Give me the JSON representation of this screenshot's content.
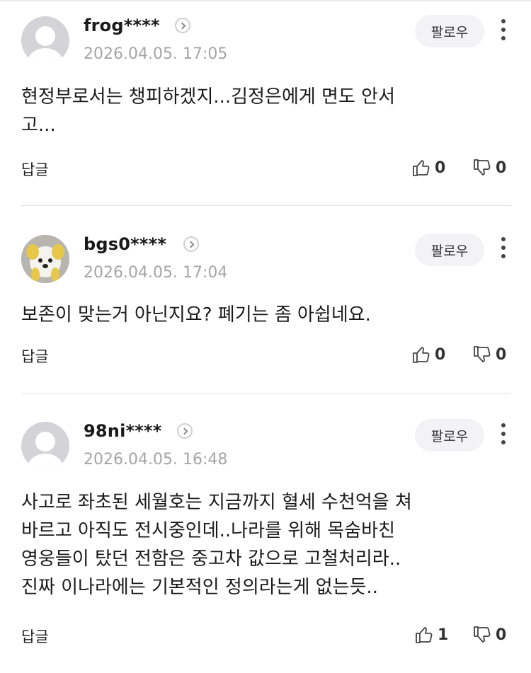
{
  "comments": [
    {
      "nickname": "frog****",
      "avatar": "default-avatar",
      "date": "2026.04.05. 17:05",
      "follow_label": "팔로우",
      "text": "현정부로서는 챙피하겠지...김정은에게 면도 안서\n고...",
      "reply_label": "답글",
      "likes": "0",
      "dislikes": "0"
    },
    {
      "nickname": "bgs0****",
      "avatar": "dog-photo-avatar",
      "date": "2026.04.05. 17:04",
      "follow_label": "팔로우",
      "text": "보존이 맞는거 아닌지요? 폐기는 좀 아쉽네요.",
      "reply_label": "답글",
      "likes": "0",
      "dislikes": "0"
    },
    {
      "nickname": "98ni****",
      "avatar": "default-avatar",
      "date": "2026.04.05. 16:48",
      "follow_label": "팔로우",
      "text": "사고로 좌초된 세월호는 지금까지 혈세 수천억을 쳐\n바르고 아직도 전시중인데..나라를 위해 목숨바친\n영웅들이 탔던 전함은 중고차 값으로 고철처리라..\n진짜 이나라에는 기본적인 정의라는게 없는듯..",
      "reply_label": "답글",
      "likes": "1",
      "dislikes": "0"
    }
  ],
  "icons": {
    "like": "thumbs-up-icon",
    "dislike": "thumbs-down-icon",
    "more": "more-vertical-icon",
    "nickname_link": "chevron-right-circle-icon"
  },
  "colors": {
    "date": "#a5a5a5",
    "follow_bg": "#f3f3f5",
    "divider": "#e2e2e2"
  }
}
